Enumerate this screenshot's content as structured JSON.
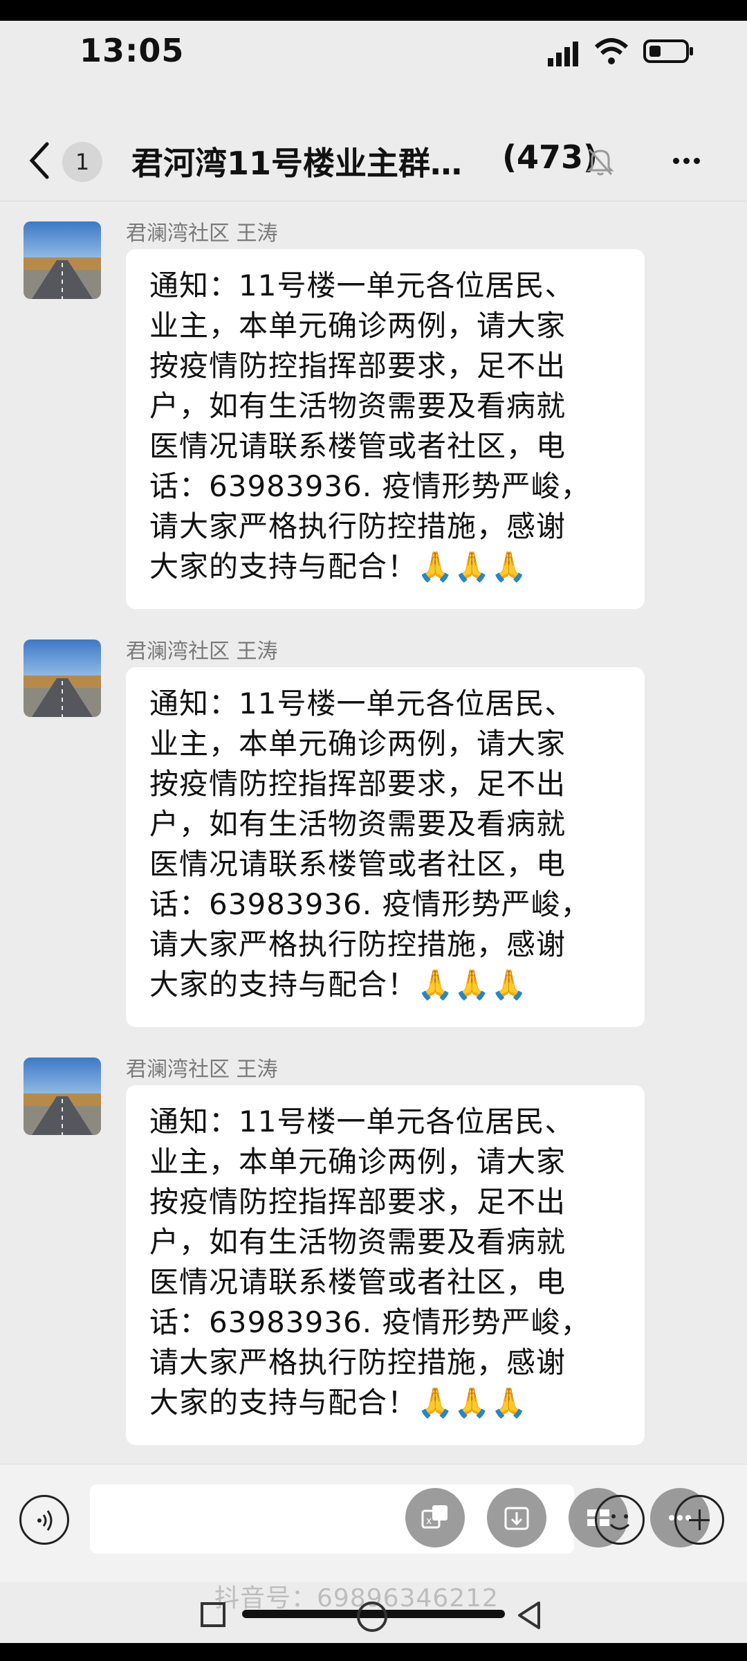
{
  "status": {
    "time": "13:05"
  },
  "header": {
    "unread": "1",
    "title": "君河湾11号楼业主群…",
    "member_count": "(473)"
  },
  "messages": [
    {
      "sender": "君澜湾社区  王涛",
      "text": "通知：11号楼一单元各位居民、\n业主，本单元确诊两例，请大家\n按疫情防控指挥部要求，足不出\n户，如有生活物资需要及看病就\n医情况请联系楼管或者社区，电\n话：63983936. 疫情形势严峻，\n请大家严格执行防控措施，感谢\n大家的支持与配合！",
      "emoji": "🙏🙏🙏"
    },
    {
      "sender": "君澜湾社区  王涛",
      "text": "通知：11号楼一单元各位居民、\n业主，本单元确诊两例，请大家\n按疫情防控指挥部要求，足不出\n户，如有生活物资需要及看病就\n医情况请联系楼管或者社区，电\n话：63983936. 疫情形势严峻，\n请大家严格执行防控措施，感谢\n大家的支持与配合！",
      "emoji": "🙏🙏🙏"
    },
    {
      "sender": "君澜湾社区  王涛",
      "text": "通知：11号楼一单元各位居民、\n业主，本单元确诊两例，请大家\n按疫情防控指挥部要求，足不出\n户，如有生活物资需要及看病就\n医情况请联系楼管或者社区，电\n话：63983936. 疫情形势严峻，\n请大家严格执行防控措施，感谢\n大家的支持与配合！",
      "emoji": "🙏🙏🙏"
    }
  ],
  "watermark": "抖音号：69896346212",
  "icons": {
    "back": "chevron-left-icon",
    "mute": "bell-off-icon",
    "more": "more-dots-icon",
    "voice": "voice-icon",
    "emoji": "emoji-icon",
    "plus": "plus-icon"
  }
}
